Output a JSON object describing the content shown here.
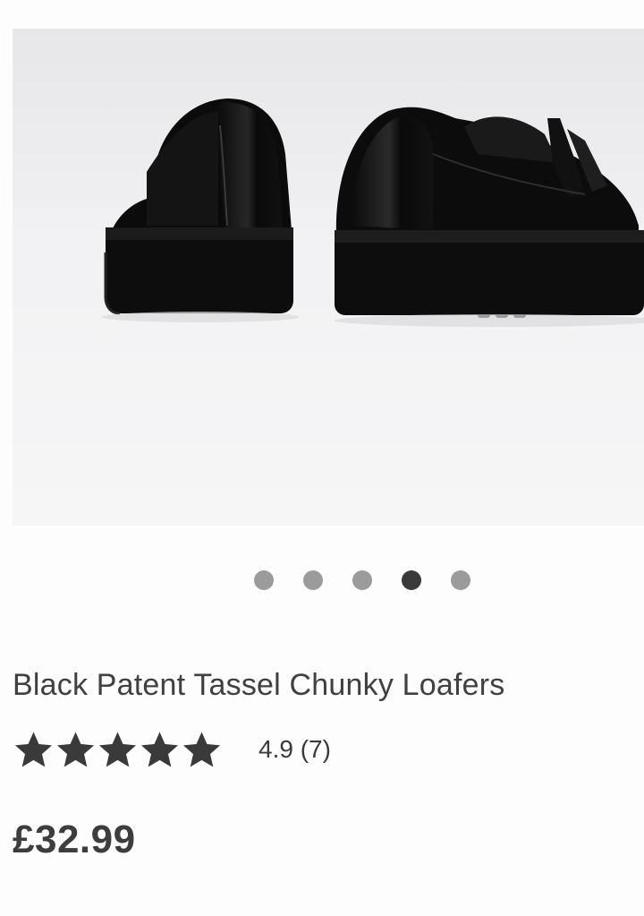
{
  "product": {
    "image_alt": "Black patent tassel chunky loafers, rear view",
    "gallery": {
      "dot_count": 5,
      "active_index": 3
    },
    "title": "Black Patent Tassel Chunky Loafers",
    "rating": {
      "stars": 5,
      "score_label": "4.9 (7)"
    },
    "price": "£32.99"
  }
}
